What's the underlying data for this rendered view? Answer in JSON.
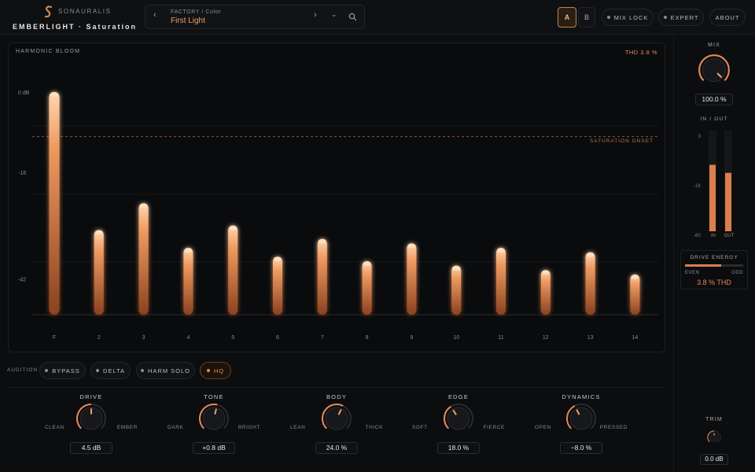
{
  "header": {
    "brand": "SONAURALIS",
    "title": "EMBERLIGHT · Saturation",
    "preset": {
      "category": "FACTORY / Color",
      "name": "First Light"
    },
    "ab": {
      "a": "A",
      "b": "B",
      "active": "A"
    },
    "buttons": {
      "mix_lock": "MIX LOCK",
      "expert": "EXPERT",
      "about": "ABOUT"
    },
    "icons": {
      "prev": "chevron-left-icon",
      "next": "chevron-right-icon",
      "menu": "chevron-down-icon",
      "search": "search-icon"
    }
  },
  "harmonics": {
    "title": "HARMONIC BLOOM",
    "thd": "THD 3.8 %",
    "onset_label": "SATURATION ONSET",
    "y_labels": [
      "0 dB",
      "-18",
      "-42"
    ],
    "accent": "#e58a55"
  },
  "chart_data": {
    "type": "bar",
    "title": "HARMONIC BLOOM",
    "categories": [
      "F",
      "2",
      "3",
      "4",
      "5",
      "6",
      "7",
      "8",
      "9",
      "10",
      "11",
      "12",
      "13",
      "14"
    ],
    "values": [
      0,
      -31,
      -25,
      -35,
      -30,
      -37,
      -33,
      -38,
      -34,
      -39,
      -35,
      -40,
      -36,
      -41
    ],
    "ylim": [
      -50,
      0
    ],
    "y_ticks": [
      0,
      -18,
      -42
    ],
    "saturation_onset_db": -10
  },
  "audition": {
    "label": "AUDITION",
    "bypass": "BYPASS",
    "delta": "DELTA",
    "harm_solo": "HARM SOLO",
    "hq": "HQ",
    "hq_active": true
  },
  "knobs": {
    "drive": {
      "label": "DRIVE",
      "min": "CLEAN",
      "max": "EMBER",
      "value": "4.5 dB",
      "position": 0.5
    },
    "tone": {
      "label": "TONE",
      "min": "DARK",
      "max": "BRIGHT",
      "value": "+0.8 dB",
      "position": 0.55
    },
    "body": {
      "label": "BODY",
      "min": "LEAN",
      "max": "THICK",
      "value": "24.0 %",
      "position": 0.6
    },
    "edge": {
      "label": "EDGE",
      "min": "SOFT",
      "max": "FIERCE",
      "value": "18.0 %",
      "position": 0.38
    },
    "dynamics": {
      "label": "DYNAMICS",
      "min": "OPEN",
      "max": "PRESSED",
      "value": "−8.0 %",
      "position": 0.4
    }
  },
  "sidebar": {
    "mix": {
      "label": "MIX",
      "value": "100.0 %",
      "position": 1.0
    },
    "meters": {
      "label": "IN / OUT",
      "scale": [
        "0",
        "-18",
        "-60"
      ],
      "in_label": "IN",
      "out_label": "OUT",
      "in_level": 0.66,
      "out_level": 0.58
    },
    "drive_energy": {
      "title": "DRIVE ENERGY",
      "even": "EVEN",
      "odd": "ODD",
      "value": "3.8 % THD",
      "balance": 0.62
    },
    "trim": {
      "label": "TRIM",
      "value": "0.0 dB",
      "position": 0.5
    }
  }
}
